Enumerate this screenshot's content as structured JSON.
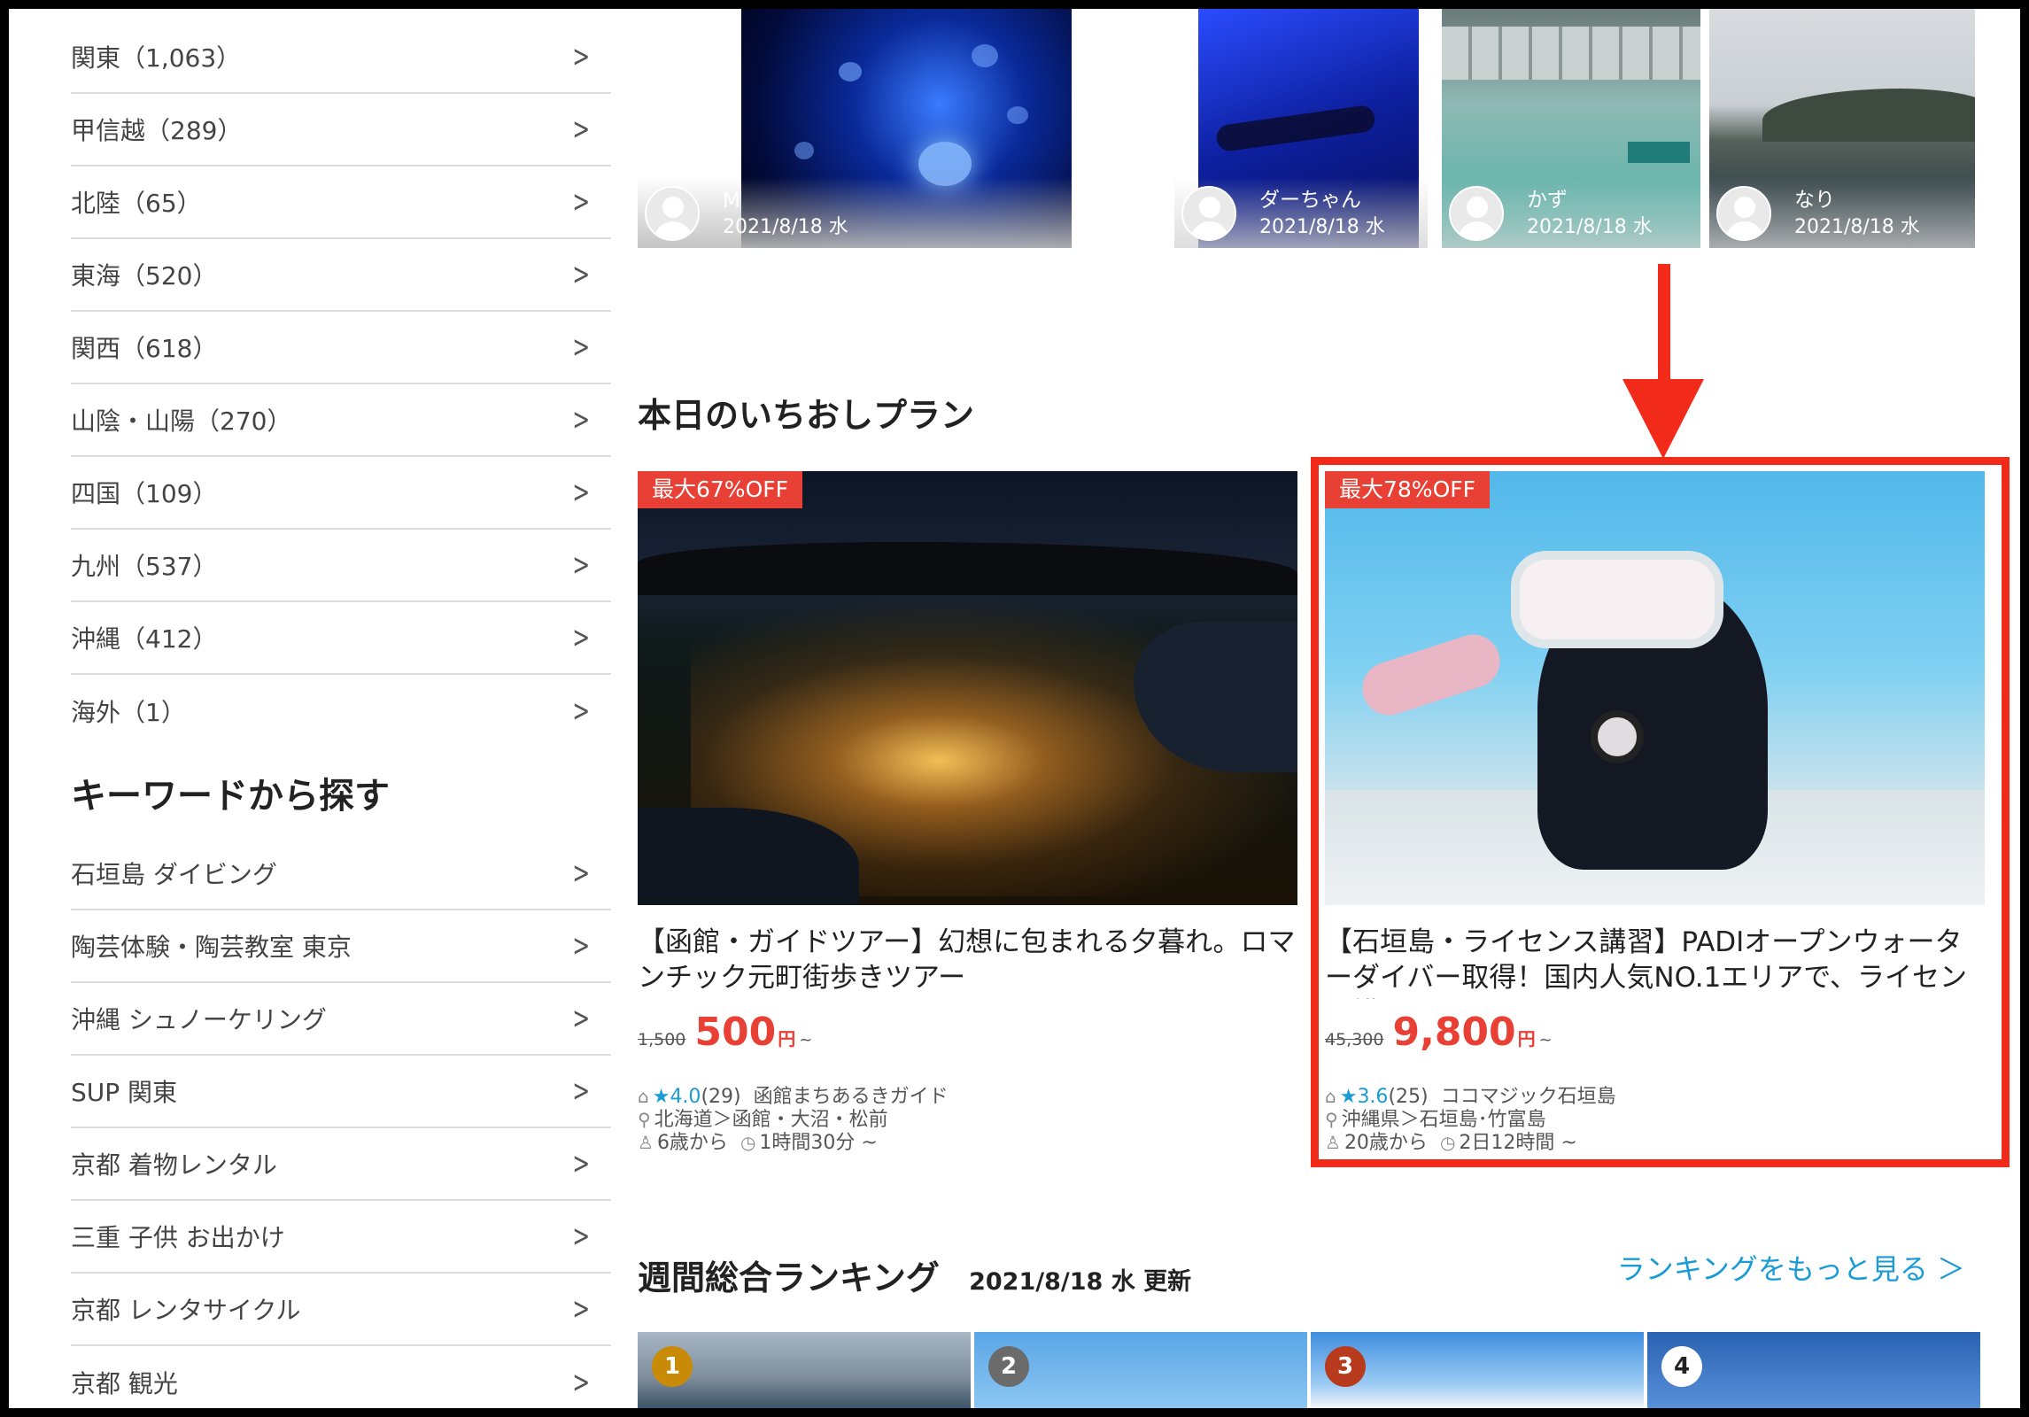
{
  "sidebar": {
    "regions": [
      {
        "label": "関東（1,063）"
      },
      {
        "label": "甲信越（289）"
      },
      {
        "label": "北陸（65）"
      },
      {
        "label": "東海（520）"
      },
      {
        "label": "関西（618）"
      },
      {
        "label": "山陰・山陽（270）"
      },
      {
        "label": "四国（109）"
      },
      {
        "label": "九州（537）"
      },
      {
        "label": "沖縄（412）"
      },
      {
        "label": "海外（1）"
      }
    ],
    "keyword_heading": "キーワードから探す",
    "keywords": [
      {
        "label": "石垣島 ダイビング"
      },
      {
        "label": "陶芸体験・陶芸教室 東京"
      },
      {
        "label": "沖縄 シュノーケリング"
      },
      {
        "label": "SUP 関東"
      },
      {
        "label": "京都 着物レンタル"
      },
      {
        "label": "三重 子供 お出かけ"
      },
      {
        "label": "京都 レンタサイクル"
      },
      {
        "label": "京都 観光"
      }
    ],
    "chevron": ">"
  },
  "photos": [
    {
      "name": "M",
      "date": "2021/8/18 水"
    },
    {
      "name": "ダーちゃん",
      "date": "2021/8/18 水"
    },
    {
      "name": "かず",
      "date": "2021/8/18 水"
    },
    {
      "name": "なり",
      "date": "2021/8/18 水"
    }
  ],
  "plans_section": {
    "title": "本日のいちおしプラン"
  },
  "plans": [
    {
      "badge": "最大67%OFF",
      "title": "【函館・ガイドツアー】幻想に包まれる夕暮れ。ロマンチック元町街歩きツアー",
      "old_price": "1,500",
      "price": "500",
      "yen": "円",
      "tilde": "~",
      "rating": "4.0",
      "reviews": "(29)",
      "shop": "函館まちあるきガイド",
      "location": "北海道＞函館・大沼・松前",
      "age": "6歳から",
      "duration": "1時間30分 ~"
    },
    {
      "badge": "最大78%OFF",
      "title": "【石垣島・ライセンス講習】PADIオープンウォーターダイバー取得！国内人気NO.1エリアで、ライセンス講習へ",
      "old_price": "45,300",
      "price": "9,800",
      "yen": "円",
      "tilde": "~",
      "rating": "3.6",
      "reviews": "(25)",
      "shop": "ココマジック石垣島",
      "location": "沖縄県＞石垣島･竹富島",
      "age": "20歳から",
      "duration": "2日12時間 ~"
    }
  ],
  "ranking": {
    "title": "週間総合ランキング",
    "updated": "2021/8/18 水 更新",
    "more_link": "ランキングをもっと見る ＞",
    "ranks": [
      "1",
      "2",
      "3",
      "4"
    ]
  },
  "colors": {
    "accent_red": "#e94035",
    "highlight_red": "#f22a1a",
    "link_blue": "#1a9bd7"
  }
}
